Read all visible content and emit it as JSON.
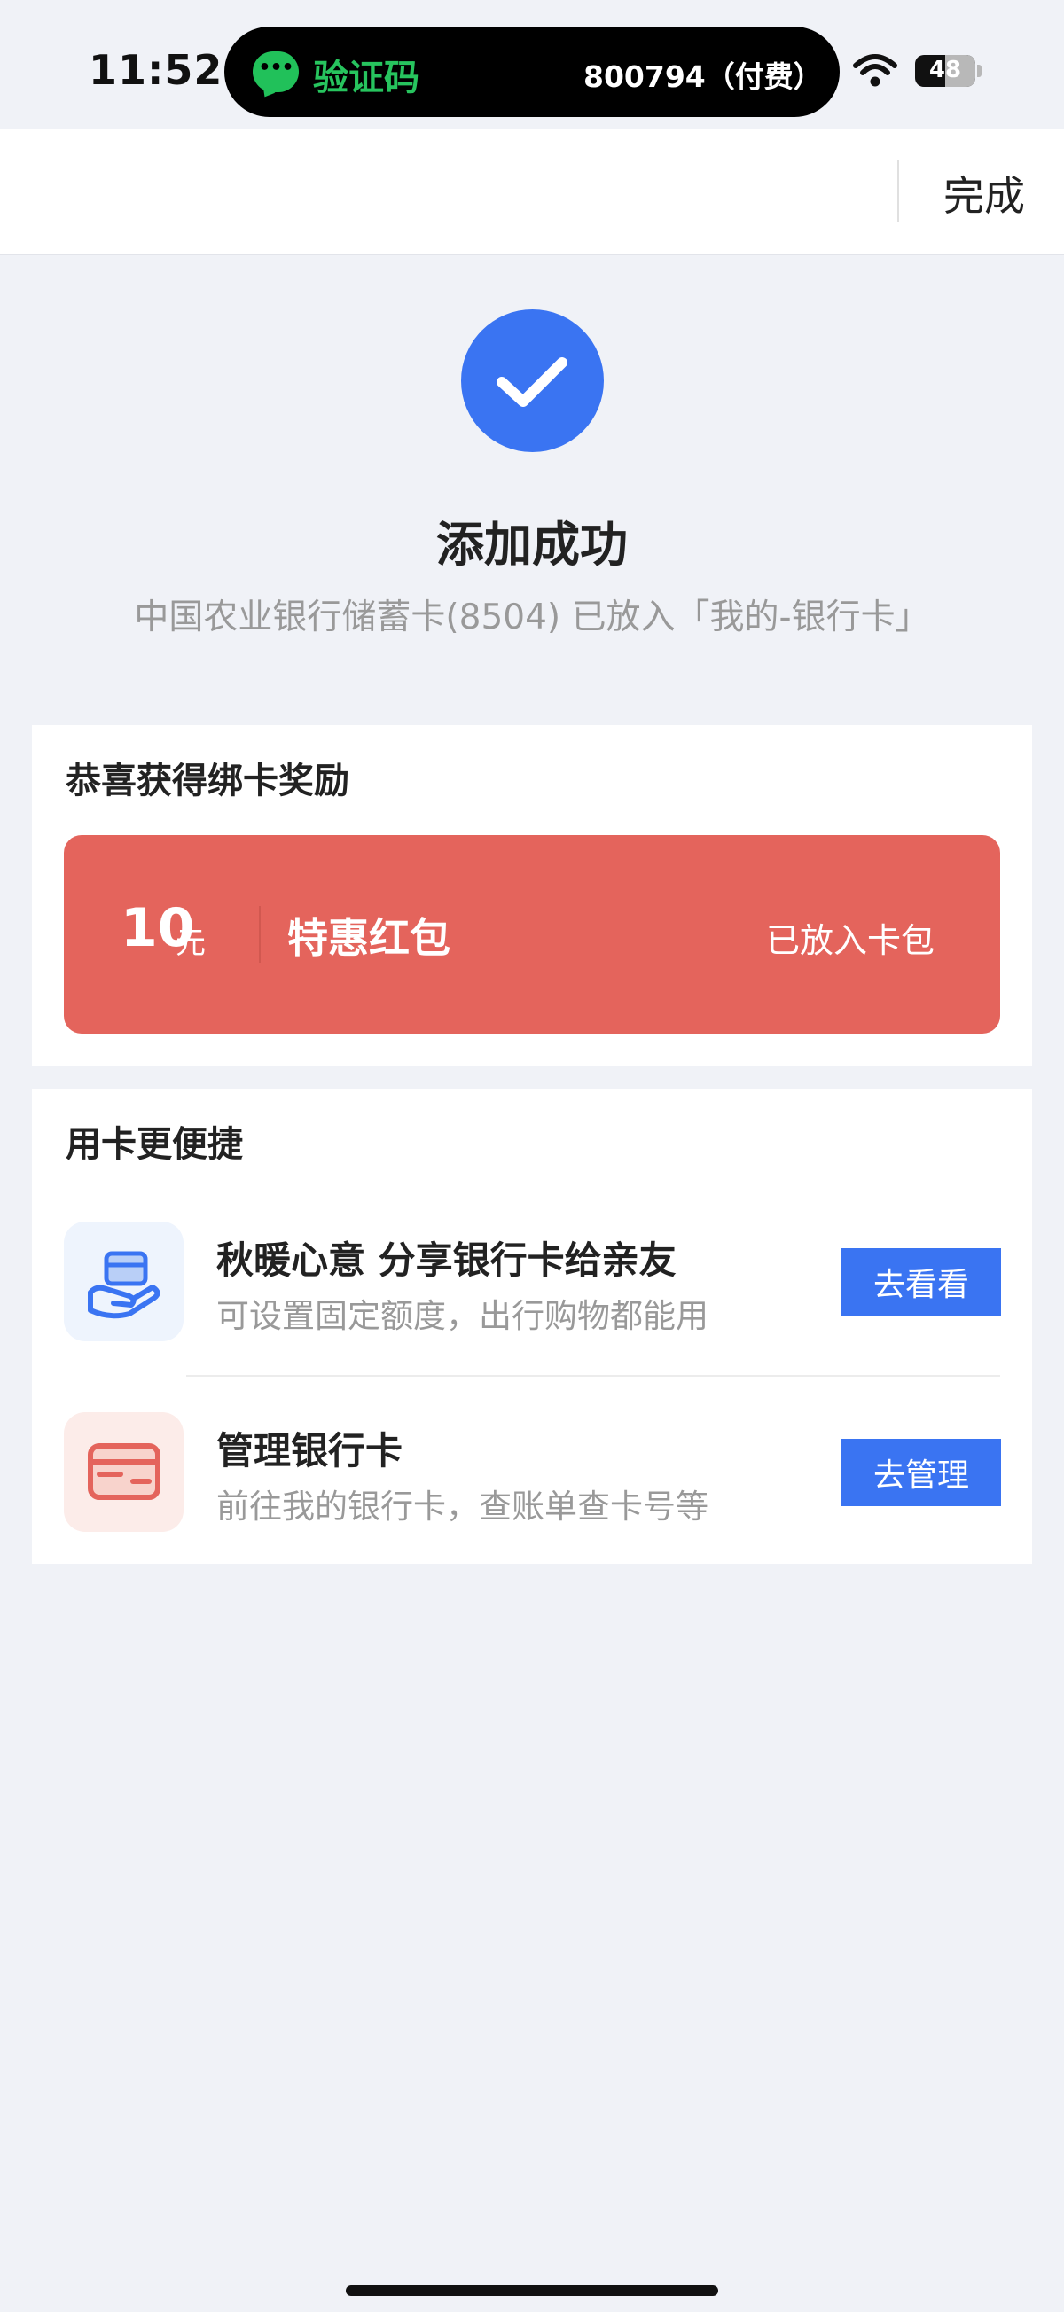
{
  "status_bar": {
    "time": "11:52",
    "notification_icon": "wechat-icon",
    "notification_title": "验证码",
    "notification_code": "800794（付费）",
    "battery": "48"
  },
  "nav": {
    "done_label": "完成"
  },
  "success": {
    "icon": "checkmark-icon",
    "title": "添加成功",
    "description": "中国农业银行储蓄卡(8504) 已放入「我的-银行卡」"
  },
  "reward": {
    "section_title": "恭喜获得绑卡奖励",
    "amount": "10",
    "unit": "元",
    "name": "特惠红包",
    "status": "已放入卡包",
    "color": "#e4645c"
  },
  "convenience": {
    "section_title": "用卡更便捷",
    "items": [
      {
        "icon": "card-in-hand-icon",
        "title": "秋暖心意 分享银行卡给亲友",
        "subtitle": "可设置固定额度，出行购物都能用",
        "button": "去看看"
      },
      {
        "icon": "bank-card-icon",
        "title": "管理银行卡",
        "subtitle": "前往我的银行卡，查账单查卡号等",
        "button": "去管理"
      }
    ]
  },
  "accent_color": "#3a74f2"
}
